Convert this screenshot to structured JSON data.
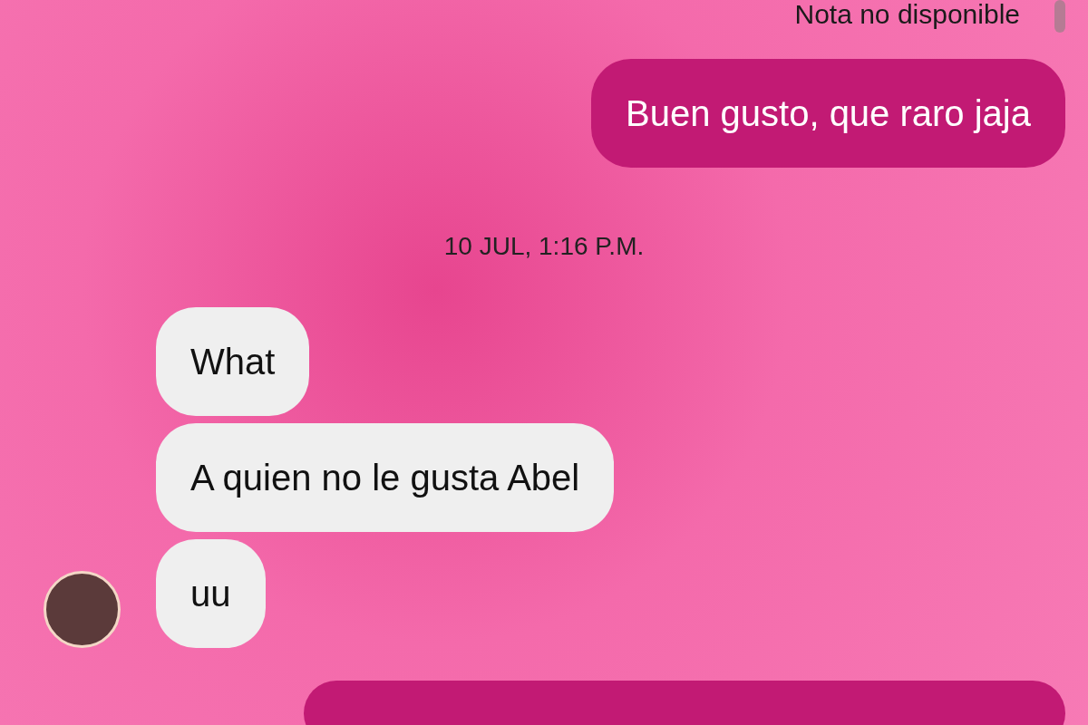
{
  "note": "Nota no disponible",
  "messages": [
    {
      "kind": "outgoing",
      "text": "Buen gusto, que raro jaja"
    },
    {
      "kind": "timestamp",
      "text": "10 JUL, 1:16 P.M."
    },
    {
      "kind": "incoming",
      "text": "What"
    },
    {
      "kind": "incoming",
      "text": "A quien no le gusta Abel"
    },
    {
      "kind": "incoming",
      "text": "uu",
      "avatar": true
    },
    {
      "kind": "outgoing"
    }
  ]
}
